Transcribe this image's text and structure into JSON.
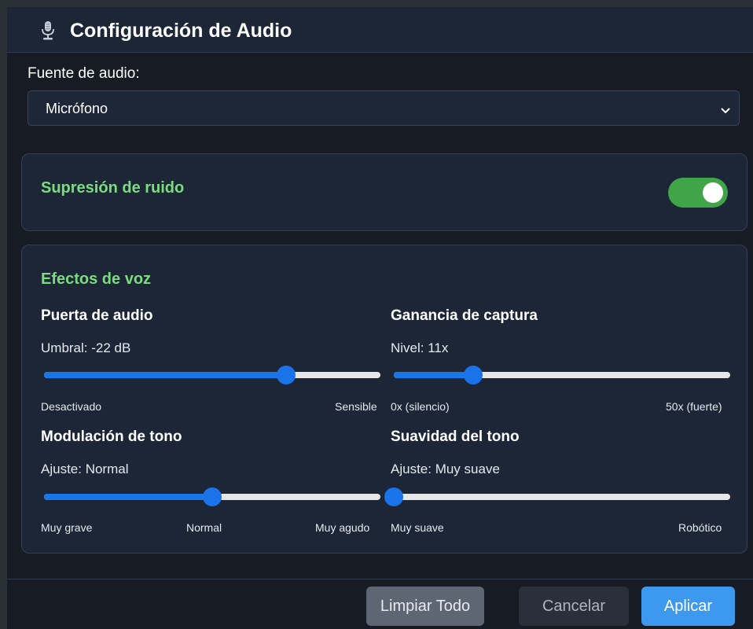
{
  "header": {
    "title": "Configuración de Audio",
    "icon": "microphone-icon"
  },
  "source": {
    "label": "Fuente de audio:",
    "selected": "Micrófono"
  },
  "noise": {
    "title": "Supresión de ruido",
    "enabled": true,
    "accent": "#3fa548"
  },
  "effects": {
    "title": "Efectos de voz",
    "gate": {
      "title": "Puerta de audio",
      "value_label": "Umbral: -22 dB",
      "level": 0.72,
      "min_label": "Desactivado",
      "max_label": "Sensible"
    },
    "gain": {
      "title": "Ganancia de captura",
      "value_label": "Nivel: 11x",
      "level": 0.235,
      "min_label": "0x (silencio)",
      "max_label": "50x (fuerte)"
    },
    "pitch": {
      "title": "Modulación de tono",
      "value_label": "Ajuste: Normal",
      "level": 0.5,
      "min_label": "Muy grave",
      "mid_label": "Normal",
      "max_label": "Muy agudo"
    },
    "smooth": {
      "title": "Suavidad del tono",
      "value_label": "Ajuste: Muy suave",
      "level": 0.0,
      "min_label": "Muy suave",
      "max_label": "Robótico"
    }
  },
  "footer": {
    "clear_label": "Limpiar Todo",
    "cancel_label": "Cancelar",
    "apply_label": "Aplicar"
  },
  "colors": {
    "accent_blue": "#1a73e8",
    "title_green": "#7bdc7e",
    "apply_button": "#3d99ee"
  }
}
